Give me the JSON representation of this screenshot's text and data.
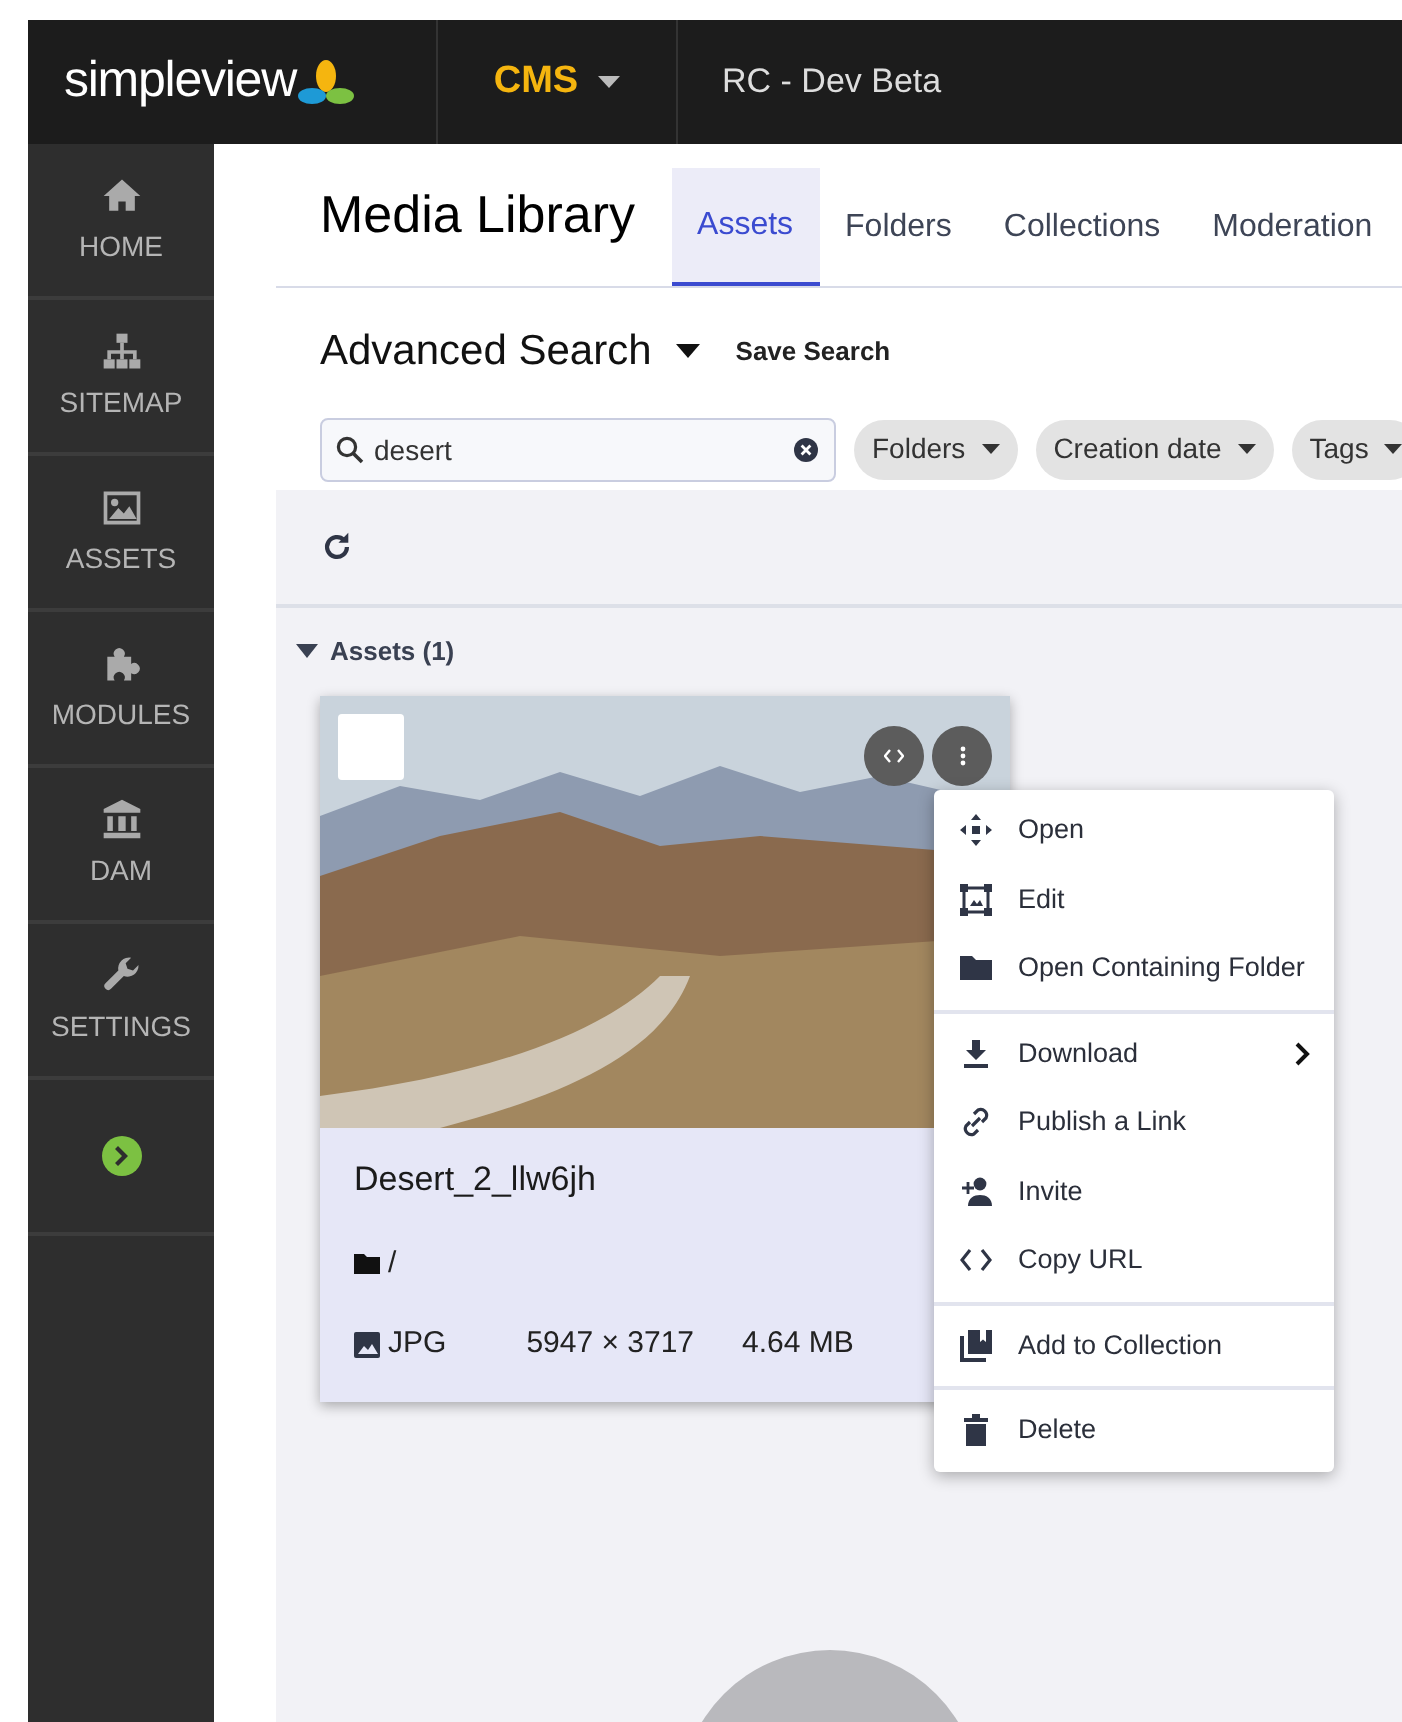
{
  "topbar": {
    "logo": "simpleview",
    "app_menu": "CMS",
    "site": "RC - Dev Beta"
  },
  "sidebar": [
    {
      "kind": "nav",
      "label": "HOME"
    },
    {
      "kind": "nav",
      "label": "SITEMAP"
    },
    {
      "kind": "nav",
      "label": "ASSETS"
    },
    {
      "kind": "nav",
      "label": "MODULES"
    },
    {
      "kind": "nav",
      "label": "DAM"
    },
    {
      "kind": "nav",
      "label": "SETTINGS"
    },
    {
      "kind": "expand"
    }
  ],
  "page_title": "Media Library",
  "tabs": [
    {
      "label": "Assets",
      "selected": true
    },
    {
      "label": "Folders",
      "selected": false
    },
    {
      "label": "Collections",
      "selected": false
    },
    {
      "label": "Moderation",
      "selected": false
    }
  ],
  "search_bar": {
    "title": "Advanced Search",
    "save": "Save Search",
    "query": "desert",
    "filters": [
      "Folders",
      "Creation date",
      "Tags"
    ]
  },
  "results": {
    "group": "Assets (1)",
    "expanded": true,
    "asset": {
      "name": "Desert_2_llw6jh",
      "folder": "/",
      "type": "JPG",
      "dimensions": "5947 × 3717",
      "size": "4.64 MB",
      "checked": false
    }
  },
  "context_menu": [
    [
      {
        "label": "Open",
        "submenu": false
      },
      {
        "label": "Edit",
        "submenu": false
      },
      {
        "label": "Open Containing Folder",
        "submenu": false
      }
    ],
    [
      {
        "label": "Download",
        "submenu": true
      },
      {
        "label": "Publish a Link",
        "submenu": false
      },
      {
        "label": "Invite",
        "submenu": false
      },
      {
        "label": "Copy URL",
        "submenu": false
      }
    ],
    [
      {
        "label": "Add to Collection",
        "submenu": false
      }
    ],
    [
      {
        "label": "Delete",
        "submenu": false
      }
    ]
  ]
}
